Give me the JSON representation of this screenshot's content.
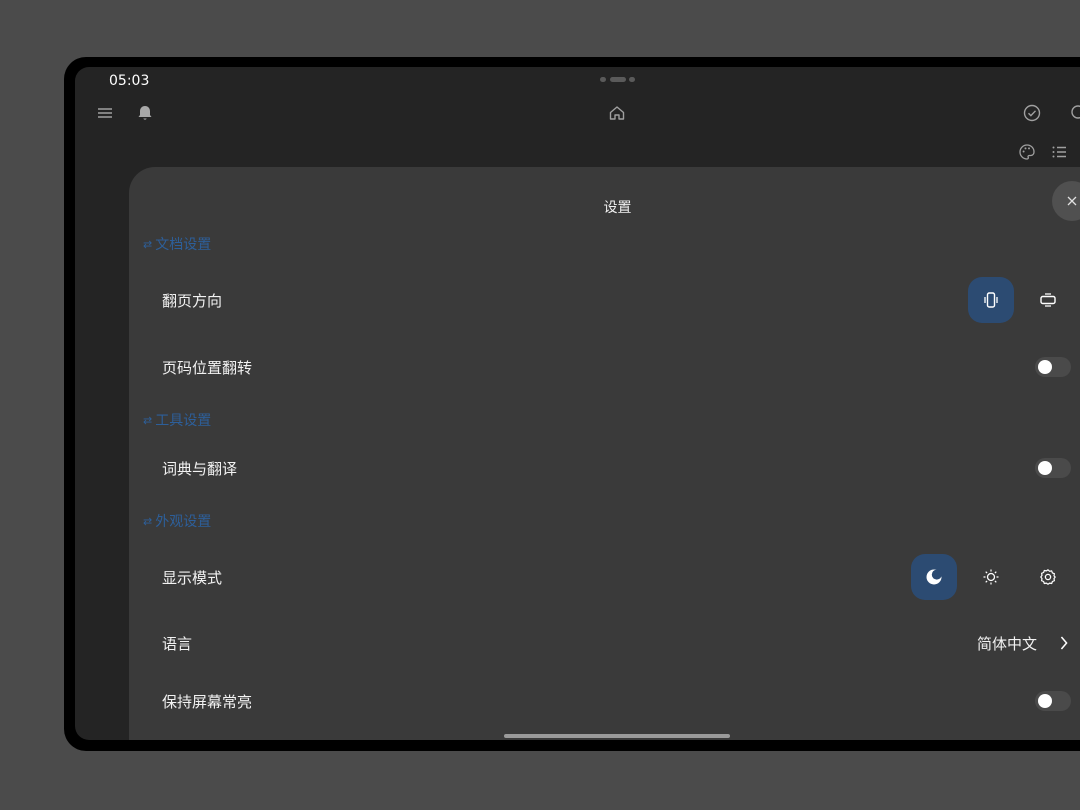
{
  "status_bar": {
    "time": "05:03"
  },
  "toolbar": {
    "icons": [
      "menu-icon",
      "bell-icon",
      "home-icon",
      "check-circle-icon",
      "search-icon",
      "palette-icon",
      "list-icon"
    ]
  },
  "settings": {
    "title": "设置",
    "sections": {
      "document": {
        "title": "文档设置"
      },
      "tools": {
        "title": "工具设置"
      },
      "appearance": {
        "title": "外观设置"
      }
    },
    "rows": {
      "page_direction": {
        "label": "翻页方向",
        "options": [
          "vertical",
          "horizontal"
        ],
        "selected": "vertical"
      },
      "page_number_flip": {
        "label": "页码位置翻转",
        "enabled": false
      },
      "dictionary": {
        "label": "词典与翻译",
        "enabled": false
      },
      "display_mode": {
        "label": "显示模式",
        "options": [
          "dark",
          "light",
          "system"
        ],
        "selected": "dark"
      },
      "language": {
        "label": "语言",
        "value": "简体中文"
      },
      "keep_screen_on": {
        "label": "保持屏幕常亮",
        "enabled": false
      }
    }
  },
  "colors": {
    "background": "#4b4b4b",
    "screen": "#242424",
    "sheet": "#3a3a3a",
    "accent": "#2c4b72",
    "section_text": "#2d5f9a"
  }
}
